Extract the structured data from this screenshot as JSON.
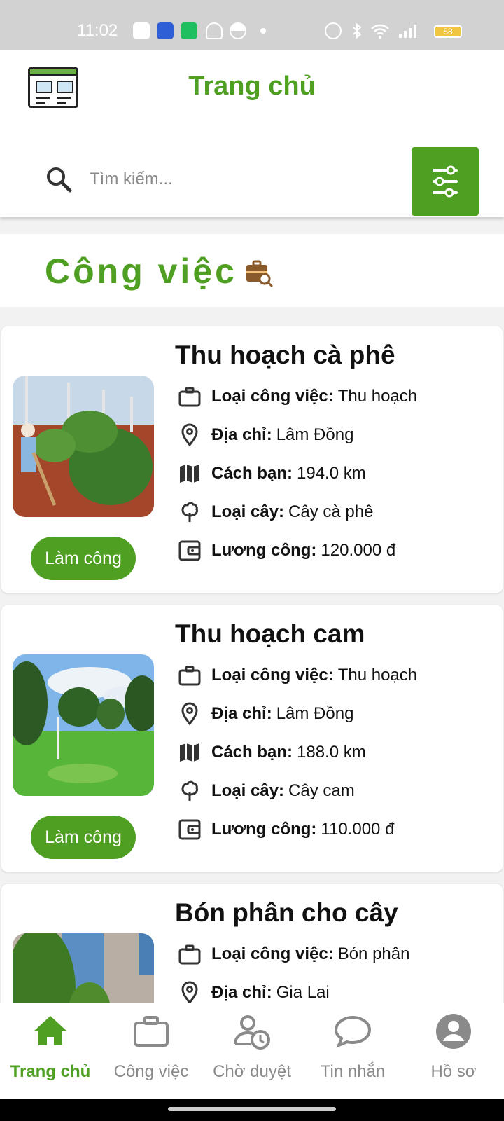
{
  "status_bar": {
    "time": "11:02",
    "battery": "58",
    "icons": [
      "zalo-icon",
      "hotspot-icon",
      "chat-icon",
      "bell-icon",
      "half-circle-icon",
      "dot-icon",
      "alarm-icon",
      "bluetooth-icon",
      "wifi-icon",
      "signal-icon",
      "battery-icon"
    ]
  },
  "header": {
    "title": "Trang chủ",
    "search_placeholder": "Tìm kiếm..."
  },
  "section": {
    "title": "Công việc"
  },
  "labels": {
    "job_type": "Loại công việc:",
    "address": "Địa chỉ:",
    "distance": "Cách bạn:",
    "plant": "Loại cây:",
    "wage": "Lương công:",
    "work_button": "Làm công"
  },
  "jobs": [
    {
      "title": "Thu hoạch cà phê",
      "job_type": "Thu hoạch",
      "address": "Lâm Đồng",
      "distance": "194.0 km",
      "plant": "Cây cà phê",
      "wage": "120.000 đ"
    },
    {
      "title": "Thu hoạch cam",
      "job_type": "Thu hoạch",
      "address": "Lâm Đồng",
      "distance": "188.0 km",
      "plant": "Cây cam",
      "wage": "110.000 đ"
    },
    {
      "title": "Bón phân cho cây",
      "job_type": "Bón phân",
      "address": "Gia Lai"
    }
  ],
  "nav": [
    {
      "label": "Trang chủ",
      "icon": "home-icon",
      "active": true
    },
    {
      "label": "Công việc",
      "icon": "briefcase-icon",
      "active": false
    },
    {
      "label": "Chờ duyệt",
      "icon": "pending-user-icon",
      "active": false
    },
    {
      "label": "Tin nhắn",
      "icon": "chat-bubble-icon",
      "active": false
    },
    {
      "label": "Hồ sơ",
      "icon": "profile-icon",
      "active": false
    }
  ],
  "colors": {
    "brand_green": "#4fa022",
    "status_bar": "#d2d2d2",
    "inactive_gray": "#8a8a8a"
  }
}
